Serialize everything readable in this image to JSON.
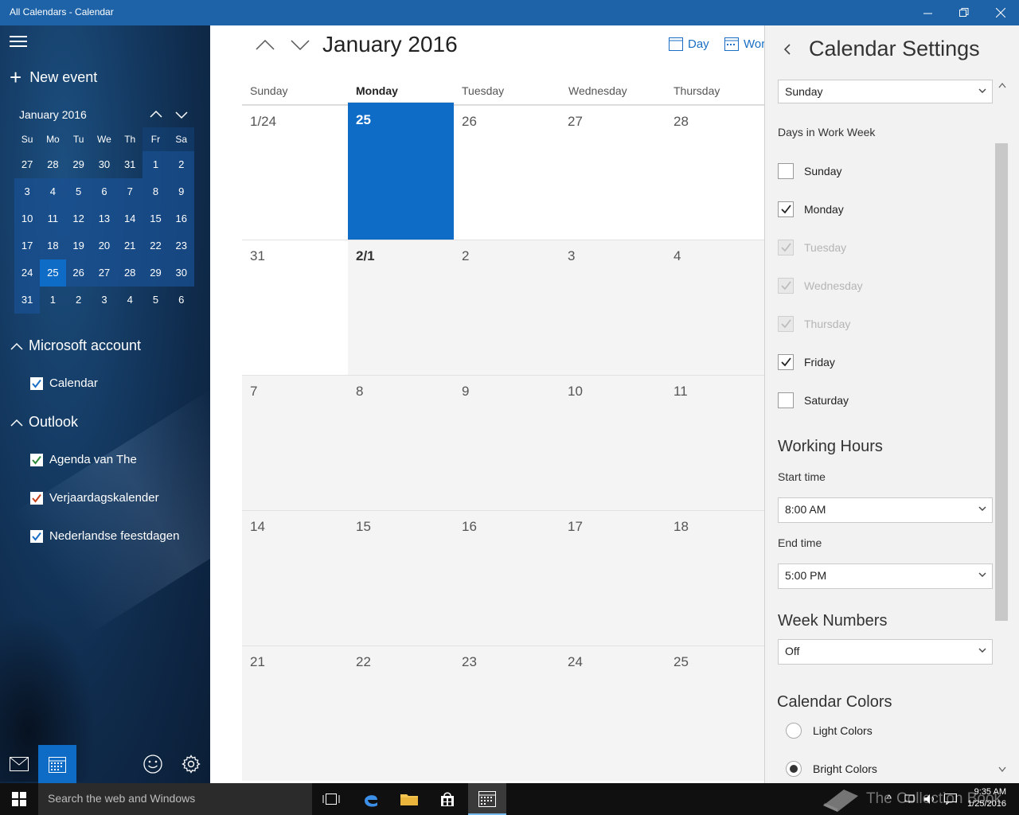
{
  "window": {
    "title": "All Calendars - Calendar"
  },
  "left": {
    "new_event": "New event",
    "mini_calendar": {
      "title": "January 2016",
      "days_of_week": [
        "Su",
        "Mo",
        "Tu",
        "We",
        "Th",
        "Fr",
        "Sa"
      ],
      "weeks": [
        [
          "27",
          "28",
          "29",
          "30",
          "31",
          "1",
          "2"
        ],
        [
          "3",
          "4",
          "5",
          "6",
          "7",
          "8",
          "9"
        ],
        [
          "10",
          "11",
          "12",
          "13",
          "14",
          "15",
          "16"
        ],
        [
          "17",
          "18",
          "19",
          "20",
          "21",
          "22",
          "23"
        ],
        [
          "24",
          "25",
          "26",
          "27",
          "28",
          "29",
          "30"
        ],
        [
          "31",
          "1",
          "2",
          "3",
          "4",
          "5",
          "6"
        ]
      ],
      "today": "25"
    },
    "accounts": [
      {
        "name": "Microsoft account",
        "calendars": [
          {
            "name": "Calendar",
            "color": "#1a6fc4"
          }
        ]
      },
      {
        "name": "Outlook",
        "calendars": [
          {
            "name": "Agenda van The",
            "color": "#2e8b3a"
          },
          {
            "name": "Verjaardagskalender",
            "color": "#c8401a"
          },
          {
            "name": "Nederlandse feestdagen",
            "color": "#1a6fc4"
          }
        ]
      }
    ]
  },
  "main": {
    "month_title": "January 2016",
    "views": {
      "day": "Day",
      "work_week": "Wor"
    },
    "weekday_headers": [
      "Sunday",
      "Monday",
      "Tuesday",
      "Wednesday",
      "Thursday"
    ],
    "weeks": [
      [
        "1/24",
        "25",
        "26",
        "27",
        "28"
      ],
      [
        "31",
        "2/1",
        "2",
        "3",
        "4"
      ],
      [
        "7",
        "8",
        "9",
        "10",
        "11"
      ],
      [
        "14",
        "15",
        "16",
        "17",
        "18"
      ],
      [
        "21",
        "22",
        "23",
        "24",
        "25"
      ]
    ]
  },
  "settings": {
    "title": "Calendar Settings",
    "first_day_of_week": "Sunday",
    "work_week_label": "Days in Work Week",
    "work_days": [
      {
        "name": "Sunday",
        "checked": false,
        "disabled": false
      },
      {
        "name": "Monday",
        "checked": true,
        "disabled": false
      },
      {
        "name": "Tuesday",
        "checked": true,
        "disabled": true
      },
      {
        "name": "Wednesday",
        "checked": true,
        "disabled": true
      },
      {
        "name": "Thursday",
        "checked": true,
        "disabled": true
      },
      {
        "name": "Friday",
        "checked": true,
        "disabled": false
      },
      {
        "name": "Saturday",
        "checked": false,
        "disabled": false
      }
    ],
    "working_hours_heading": "Working Hours",
    "start_time_label": "Start time",
    "start_time": "8:00 AM",
    "end_time_label": "End time",
    "end_time": "5:00 PM",
    "week_numbers_heading": "Week Numbers",
    "week_numbers": "Off",
    "calendar_colors_heading": "Calendar Colors",
    "color_options": [
      {
        "name": "Light Colors",
        "selected": false
      },
      {
        "name": "Bright Colors",
        "selected": true
      }
    ]
  },
  "taskbar": {
    "search_placeholder": "Search the web and Windows",
    "time": "9:35 AM",
    "date": "1/25/2016",
    "watermark": "The Collection Book"
  }
}
